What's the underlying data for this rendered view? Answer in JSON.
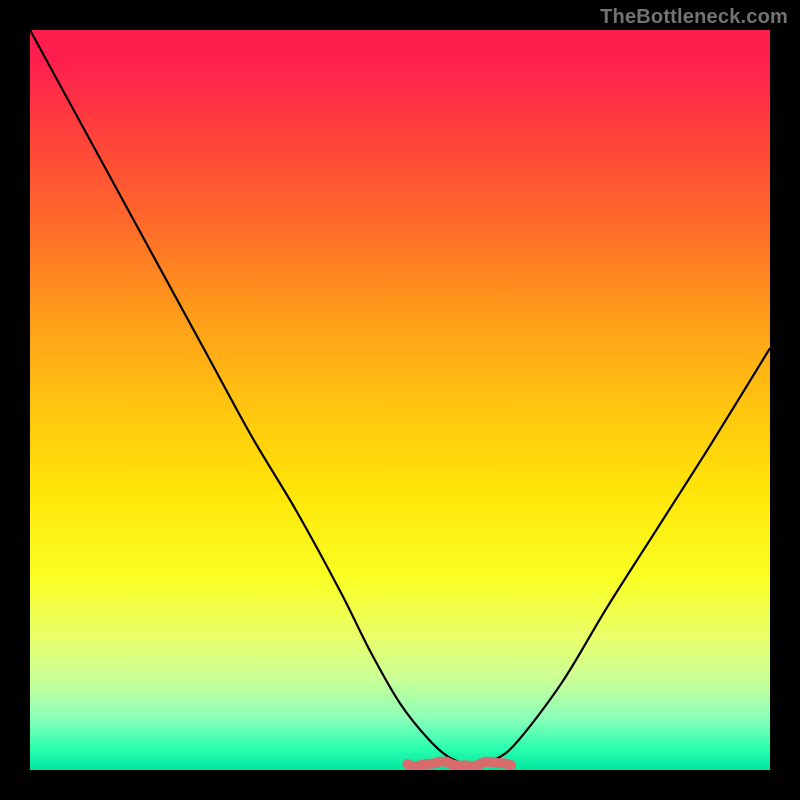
{
  "watermark": "TheBottleneck.com",
  "colors": {
    "background": "#000000",
    "curve": "#000000",
    "marker": "#d86b6b",
    "marker_stroke": "#c45a5a"
  },
  "chart_data": {
    "type": "line",
    "title": "",
    "xlabel": "",
    "ylabel": "",
    "xlim": [
      0,
      100
    ],
    "ylim": [
      0,
      100
    ],
    "grid": false,
    "legend": false,
    "series": [
      {
        "name": "bottleneck-curve",
        "x": [
          0,
          6,
          12,
          18,
          24,
          30,
          36,
          42,
          46,
          50,
          54,
          57,
          60,
          63,
          66,
          72,
          78,
          85,
          92,
          100
        ],
        "y": [
          100,
          89,
          78,
          67,
          56,
          45,
          35,
          24,
          16,
          9,
          4,
          1.5,
          0.8,
          1.5,
          4,
          12,
          22,
          33,
          44,
          57
        ]
      }
    ],
    "annotations": [
      {
        "name": "optimal-range-marker",
        "type": "segment",
        "x": [
          51,
          65
        ],
        "y": [
          0.8,
          0.8
        ]
      }
    ]
  }
}
